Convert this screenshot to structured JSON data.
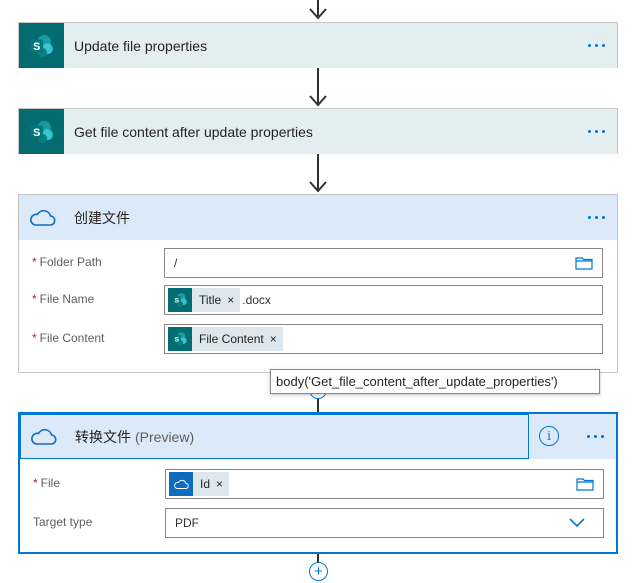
{
  "steps": [
    {
      "title": "Update file properties"
    },
    {
      "title": "Get file content after update properties"
    }
  ],
  "create_file": {
    "title": "创建文件",
    "fields": {
      "folder_path": {
        "label": "Folder Path",
        "required_mark": "*",
        "value": "/"
      },
      "file_name": {
        "label": "File Name",
        "required_mark": "*",
        "token": "Title",
        "remove_glyph": "×",
        "suffix": ".docx"
      },
      "file_content": {
        "label": "File Content",
        "required_mark": "*",
        "token": "File Content",
        "remove_glyph": "×"
      }
    }
  },
  "tooltip": {
    "text": "body('Get_file_content_after_update_properties')"
  },
  "convert_file": {
    "title": "转换文件",
    "preview": "(Preview)",
    "info_glyph": "i",
    "fields": {
      "file": {
        "label": "File",
        "required_mark": "*",
        "token": "Id",
        "remove_glyph": "×"
      },
      "target_type": {
        "label": "Target type",
        "value": "PDF"
      }
    }
  },
  "add_step_glyph": "+",
  "icons": {
    "sharepoint": "sharepoint-icon",
    "onedrive": "onedrive-icon",
    "folder": "folder-icon",
    "more": "more-icon",
    "info": "info-icon",
    "chevron": "chevron-down-icon",
    "arrow": "arrow-down-icon",
    "add": "add-icon"
  },
  "colors": {
    "sharepoint_tile": "#036c70",
    "sharepoint_header": "#e3eeee",
    "onedrive_header": "#dbe9f8",
    "accent": "#0078d4",
    "required": "#a4262c"
  }
}
